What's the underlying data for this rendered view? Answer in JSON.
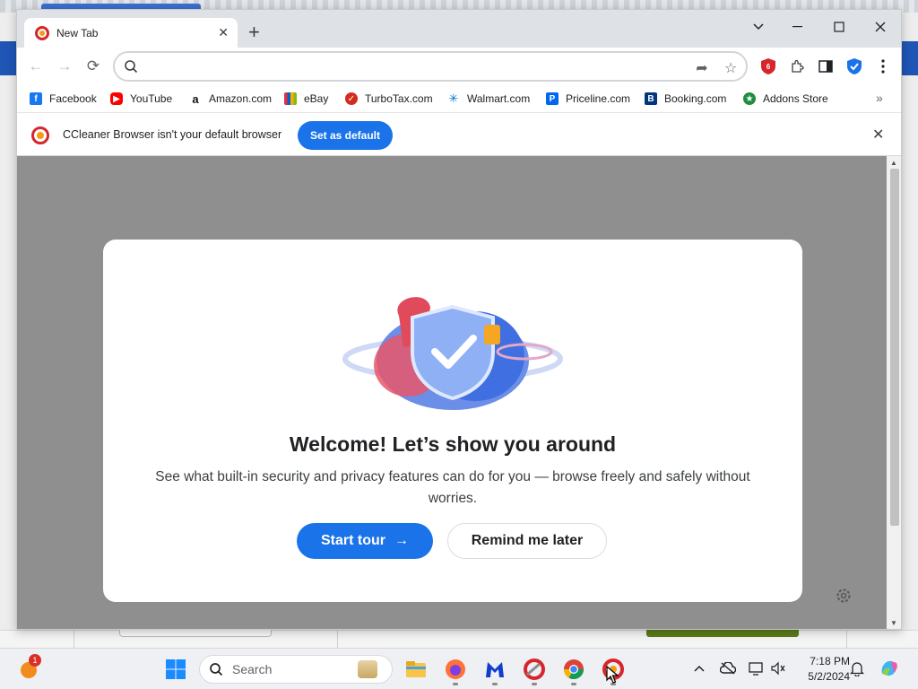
{
  "browser": {
    "tab_title": "New Tab",
    "omnibox_placeholder": "",
    "bookmarks": [
      {
        "label": "Facebook",
        "icon": "facebook-icon",
        "color": "#1877f2"
      },
      {
        "label": "YouTube",
        "icon": "youtube-icon",
        "color": "#ff0000"
      },
      {
        "label": "Amazon.com",
        "icon": "amazon-icon",
        "color": "#111111"
      },
      {
        "label": "eBay",
        "icon": "ebay-icon",
        "color": "#e53238"
      },
      {
        "label": "TurboTax.com",
        "icon": "turbotax-icon",
        "color": "#d52b1e"
      },
      {
        "label": "Walmart.com",
        "icon": "walmart-icon",
        "color": "#0071ce"
      },
      {
        "label": "Priceline.com",
        "icon": "priceline-icon",
        "color": "#0068ef"
      },
      {
        "label": "Booking.com",
        "icon": "booking-icon",
        "color": "#003580"
      },
      {
        "label": "Addons Store",
        "icon": "addons-store-icon",
        "color": "#1e8e3e"
      }
    ],
    "infobar": {
      "message": "CCleaner Browser isn't your default browser",
      "button_label": "Set as default"
    }
  },
  "welcome": {
    "title": "Welcome! Let’s show you around",
    "description": "See what built-in security and privacy features can do for you — browse freely and safely without worries.",
    "start_label": "Start tour",
    "remind_label": "Remind me later"
  },
  "taskbar": {
    "search_label": "Search",
    "notification_count": "1",
    "time": "7:18 PM",
    "date": "5/2/2024",
    "apps": [
      "start-icon",
      "file-explorer-icon",
      "firefox-icon",
      "malwarebytes-icon",
      "ccleaner-icon",
      "chrome-icon",
      "ccleaner-browser-icon"
    ]
  },
  "colors": {
    "accent": "#1a73e8",
    "overlay": "#8f8f8f",
    "brand_red": "#d7262b"
  }
}
